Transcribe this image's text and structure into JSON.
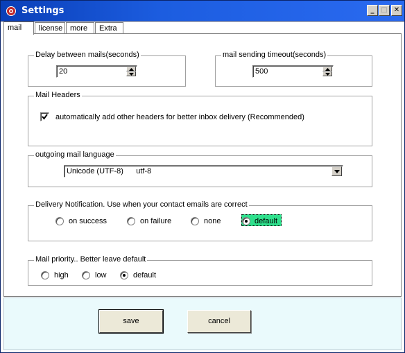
{
  "window": {
    "title": "Settings",
    "controls": {
      "minimize": "_",
      "maximize": "□",
      "close": "✕"
    }
  },
  "tabs": [
    {
      "label": "mail",
      "active": true
    },
    {
      "label": "license",
      "active": false
    },
    {
      "label": "more",
      "active": false
    },
    {
      "label": "Extra",
      "active": false
    }
  ],
  "delay": {
    "title": "Delay between mails(seconds)",
    "value": "20"
  },
  "timeout": {
    "title": "mail sending timeout(seconds)",
    "value": "500"
  },
  "headers": {
    "title": "Mail Headers",
    "checkbox_label": "automatically add other headers for better inbox delivery (Recommended)",
    "checked": true
  },
  "language": {
    "title": "outgoing mail language",
    "selected": "Unicode (UTF-8)      utf-8"
  },
  "delivery": {
    "title": "Delivery Notification. Use when your contact emails  are correct",
    "options": [
      {
        "label": "on success",
        "selected": false
      },
      {
        "label": "on failure",
        "selected": false
      },
      {
        "label": "none",
        "selected": false
      },
      {
        "label": "default",
        "selected": true
      }
    ]
  },
  "priority": {
    "title": "Mail priority.. Better leave default",
    "options": [
      {
        "label": "high",
        "selected": false
      },
      {
        "label": "low",
        "selected": false
      },
      {
        "label": "default",
        "selected": true
      }
    ]
  },
  "buttons": {
    "save": "save",
    "cancel": "cancel"
  },
  "colors": {
    "titlebar": "#1c5de0",
    "selected_highlight": "#2ee08c",
    "footer_bg": "#eafafc"
  },
  "icons": {
    "app": "cog-icon"
  }
}
